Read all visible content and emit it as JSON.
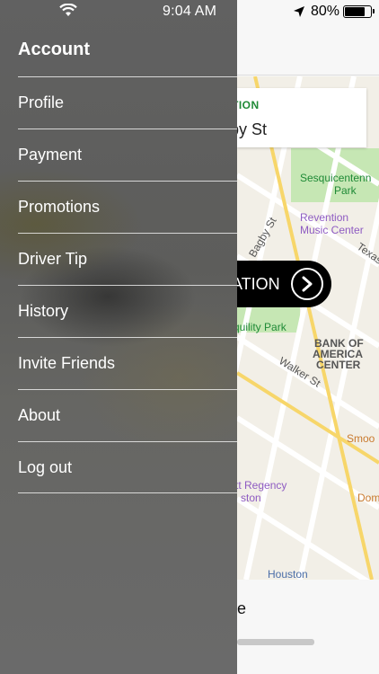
{
  "status_bar": {
    "time": "9:04 AM",
    "battery_percent": "80%",
    "battery_level": 0.8,
    "icons": [
      "wifi-icon",
      "location-arrow-icon",
      "battery-icon"
    ]
  },
  "menu": {
    "header": "Account",
    "items": [
      {
        "label": "Profile"
      },
      {
        "label": "Payment"
      },
      {
        "label": "Promotions"
      },
      {
        "label": "Driver Tip"
      },
      {
        "label": "History"
      },
      {
        "label": "Invite Friends"
      },
      {
        "label": "About"
      },
      {
        "label": "Log out"
      }
    ]
  },
  "background_app": {
    "destination_label": "TION",
    "destination_street": "by St",
    "go_button_text": "ATION",
    "go_icon": "chevron-right-circle-icon",
    "bottom_text": "e",
    "map_labels": {
      "park1": "Sesquicentenn",
      "park1_b": "Park",
      "music1": "Revention",
      "music2": "Music Center",
      "texas": "Texas",
      "street_bagby": "Bagby St",
      "park2": "quility Park",
      "bank1": "BANK OF",
      "bank2": "AMERICA",
      "bank3": "CENTER",
      "walker": "Walker St",
      "smoo": "Smoo",
      "hyatt1": "tt Regency",
      "hyatt2": "ston",
      "dom": "Dom",
      "houston": "Houston"
    },
    "colors": {
      "park_green": "#1f8a36",
      "music_purple": "#8e5bc2",
      "street_label": "#555555",
      "poi_orange": "#c97a2e",
      "transit_blue": "#4b6ea8"
    }
  }
}
